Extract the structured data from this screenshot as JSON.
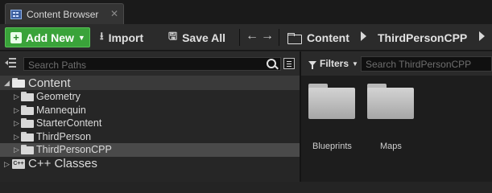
{
  "tab": {
    "title": "Content Browser",
    "close": "✕"
  },
  "toolbar": {
    "add_new": "Add New",
    "import": "Import",
    "save_all": "Save All",
    "back": "←",
    "forward": "→",
    "breadcrumbs": [
      "Content",
      "ThirdPersonCPP"
    ]
  },
  "sources": {
    "search_placeholder": "Search Paths",
    "tree": [
      {
        "label": "Content"
      },
      {
        "label": "Geometry"
      },
      {
        "label": "Mannequin"
      },
      {
        "label": "StarterContent"
      },
      {
        "label": "ThirdPerson"
      },
      {
        "label": "ThirdPersonCPP"
      },
      {
        "label": "C++ Classes",
        "icon_text": "C++"
      }
    ]
  },
  "assets": {
    "filters_label": "Filters",
    "search_placeholder": "Search ThirdPersonCPP",
    "folders": [
      {
        "label": "Blueprints"
      },
      {
        "label": "Maps"
      }
    ]
  },
  "colors": {
    "add_new_green": "#3aa33a",
    "panel_bg": "#262626",
    "selection": "#4a4a4a"
  }
}
